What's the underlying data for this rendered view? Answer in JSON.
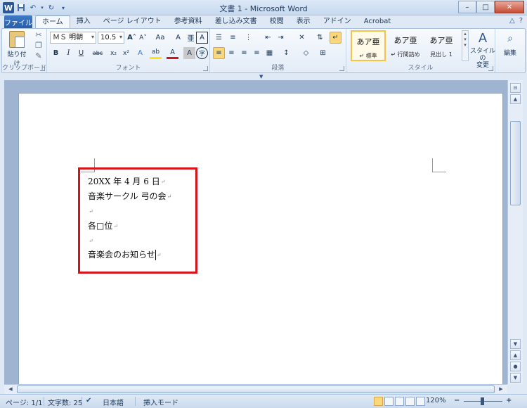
{
  "window": {
    "title": "文書 1 - Microsoft Word",
    "app_icon": "W",
    "controls": {
      "minimize": "–",
      "maximize": "□",
      "close": "✕"
    }
  },
  "qat": {
    "save_icon": "save-icon",
    "undo_icon": "undo-icon",
    "redo_icon": "redo-icon"
  },
  "tabs": {
    "file": "ファイル",
    "items": [
      {
        "label": "ホーム",
        "active": true
      },
      {
        "label": "挿入"
      },
      {
        "label": "ページ レイアウト"
      },
      {
        "label": "参考資料"
      },
      {
        "label": "差し込み文書"
      },
      {
        "label": "校閲"
      },
      {
        "label": "表示"
      },
      {
        "label": "アドイン"
      },
      {
        "label": "Acrobat"
      }
    ],
    "right_icons": {
      "minimize_ribbon": "△",
      "help": "?"
    }
  },
  "ribbon": {
    "clipboard": {
      "label": "クリップボード",
      "paste": "貼り付け"
    },
    "font": {
      "label": "フォント",
      "font_name": "ＭＳ 明朝",
      "font_size": "10.5",
      "bold": "B",
      "italic": "I",
      "underline": "U",
      "strike": "abc",
      "subscript": "x₂",
      "superscript": "x²",
      "grow": "A",
      "shrink": "A",
      "case": "Aa",
      "clear": "A",
      "highlight": "ab",
      "color": "A"
    },
    "paragraph": {
      "label": "段落"
    },
    "styles": {
      "label": "スタイル",
      "cards": [
        {
          "sample": "あア亜",
          "name": "↵ 標準",
          "selected": true
        },
        {
          "sample": "あア亜",
          "name": "↵ 行間詰め"
        },
        {
          "sample": "あア亜",
          "name": "見出し 1"
        }
      ],
      "change_styles": "スタイルの\n変更"
    },
    "editing": {
      "label": "編集"
    }
  },
  "document": {
    "lines": [
      {
        "text": "20XX 年 4 月 6 日",
        "mark": "↵"
      },
      {
        "text": "音楽サークル 弓の会",
        "mark": "↵"
      },
      {
        "text": "",
        "mark": "↵"
      },
      {
        "text": "各□位",
        "mark": "↵"
      },
      {
        "text": "",
        "mark": "↵"
      },
      {
        "text": "音楽会のお知らせ",
        "mark": "↵",
        "caret": true
      }
    ],
    "paragraph_mark": "↵",
    "annotation_color": "#d6131b"
  },
  "status": {
    "page": "ページ: 1/1",
    "words": "文字数: 25",
    "language": "日本語",
    "mode": "挿入モード",
    "zoom": "120%",
    "zoom_minus": "−",
    "zoom_plus": "+"
  },
  "colors": {
    "accent": "#2b5797",
    "ribbon_bg": "#e3ecf7",
    "highlight_box": "#d6131b"
  }
}
